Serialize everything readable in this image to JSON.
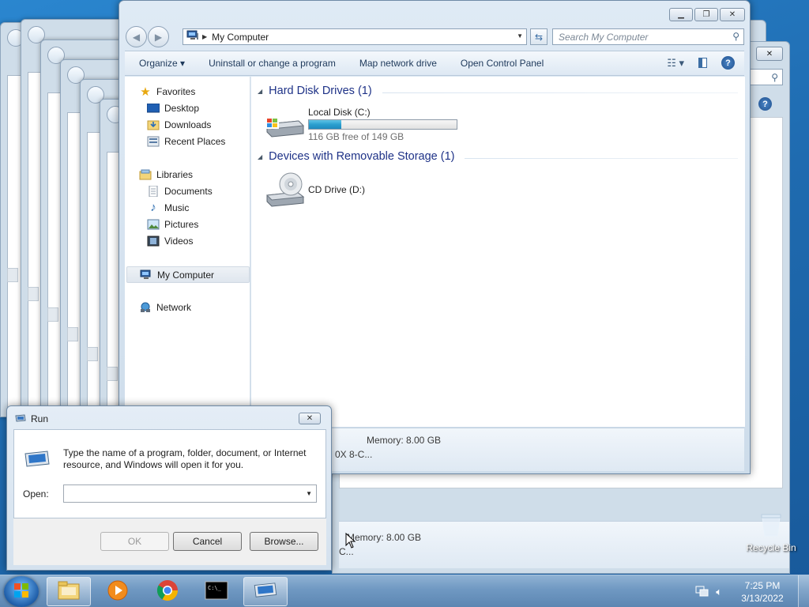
{
  "explorer": {
    "address": "My Computer",
    "search_placeholder": "Search My Computer",
    "toolbar": {
      "organize": "Organize ▾",
      "uninstall": "Uninstall or change a program",
      "map_drive": "Map network drive",
      "control_panel": "Open Control Panel"
    },
    "nav": {
      "favorites": "Favorites",
      "desktop": "Desktop",
      "downloads": "Downloads",
      "recent": "Recent Places",
      "libraries": "Libraries",
      "documents": "Documents",
      "music": "Music",
      "pictures": "Pictures",
      "videos": "Videos",
      "computer": "My Computer",
      "network": "Network"
    },
    "groups": {
      "hdd": "Hard Disk Drives (1)",
      "removable": "Devices with Removable Storage (1)"
    },
    "local_disk": {
      "name": "Local Disk (C:)",
      "free": "116 GB free of 149 GB",
      "used_fraction": 0.221
    },
    "cd_drive": "CD Drive (D:)",
    "details": {
      "memory": "Memory: 8.00 GB",
      "processor_fragment": "0X 8-C..."
    }
  },
  "background_details": {
    "memory": "Memory: 8.00 GB",
    "processor_fragment": "C..."
  },
  "run": {
    "title": "Run",
    "description": "Type the name of a program, folder, document, or Internet resource, and Windows will open it for you.",
    "open_label": "Open:",
    "open_value": "",
    "ok": "OK",
    "cancel": "Cancel",
    "browse": "Browse..."
  },
  "desktop": {
    "recycle_bin": "Recycle Bin"
  },
  "taskbar": {
    "time": "7:25 PM",
    "date": "3/13/2022"
  },
  "colors": {
    "group_header": "#1e3287",
    "taskbar": "#6f98c2",
    "progress_fill": "#2b9fcf"
  },
  "icons": [
    "windows-logo-icon",
    "folder-icon",
    "media-player-icon",
    "chrome-icon",
    "cmd-icon",
    "run-icon",
    "computer-icon",
    "hard-disk-icon",
    "cd-drive-icon",
    "star-icon",
    "network-icon"
  ]
}
